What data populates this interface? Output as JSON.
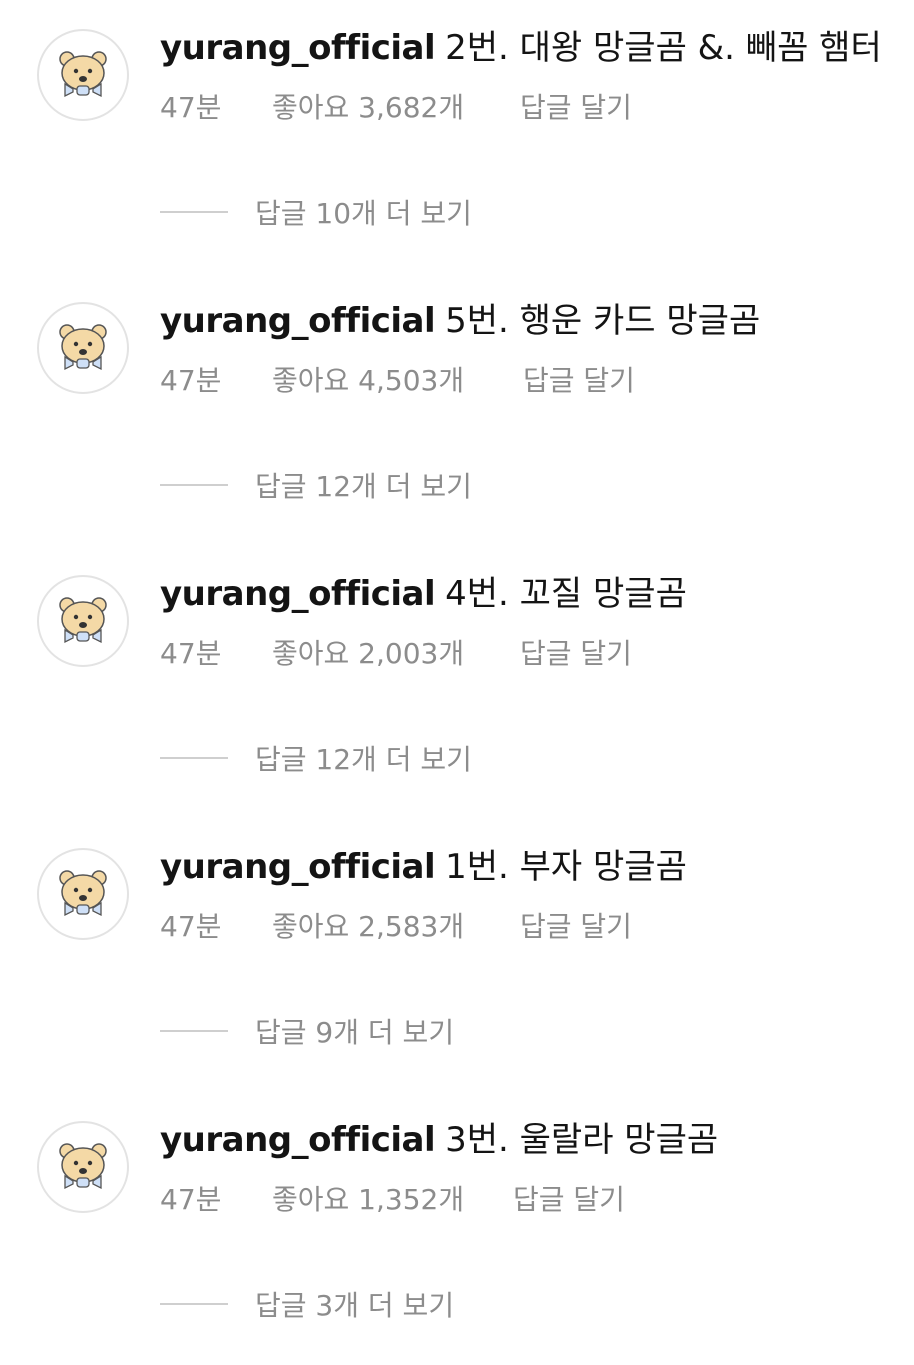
{
  "comments": [
    {
      "username": "yurang_official",
      "text": "2번. 대왕 망글곰 &. 빼꼼 햄터",
      "time": "47분",
      "likes": "좋아요 3,682개",
      "reply_label": "답글 달기",
      "view_replies": "답글 10개 더 보기"
    },
    {
      "username": "yurang_official",
      "text": "5번. 행운 카드 망글곰",
      "time": "47분",
      "likes": "좋아요 4,503개",
      "reply_label": "답글 달기",
      "view_replies": "답글 12개 더 보기"
    },
    {
      "username": "yurang_official",
      "text": "4번. 꼬질 망글곰",
      "time": "47분",
      "likes": "좋아요 2,003개",
      "reply_label": "답글 달기",
      "view_replies": "답글 12개 더 보기"
    },
    {
      "username": "yurang_official",
      "text": "1번. 부자 망글곰",
      "time": "47분",
      "likes": "좋아요 2,583개",
      "reply_label": "답글 달기",
      "view_replies": "답글 9개 더 보기"
    },
    {
      "username": "yurang_official",
      "text": "3번. 울랄라 망글곰",
      "time": "47분",
      "likes": "좋아요 1,352개",
      "reply_label": "답글 달기",
      "view_replies": "답글 3개 더 보기"
    }
  ],
  "avatar_icon": "bear-mascot-icon",
  "colors": {
    "text": "#141414",
    "muted": "#8c8c8c",
    "divider": "#cfcfcf",
    "avatar_bear": "#f4d9a6",
    "avatar_ribbon": "#cfe0f7"
  }
}
